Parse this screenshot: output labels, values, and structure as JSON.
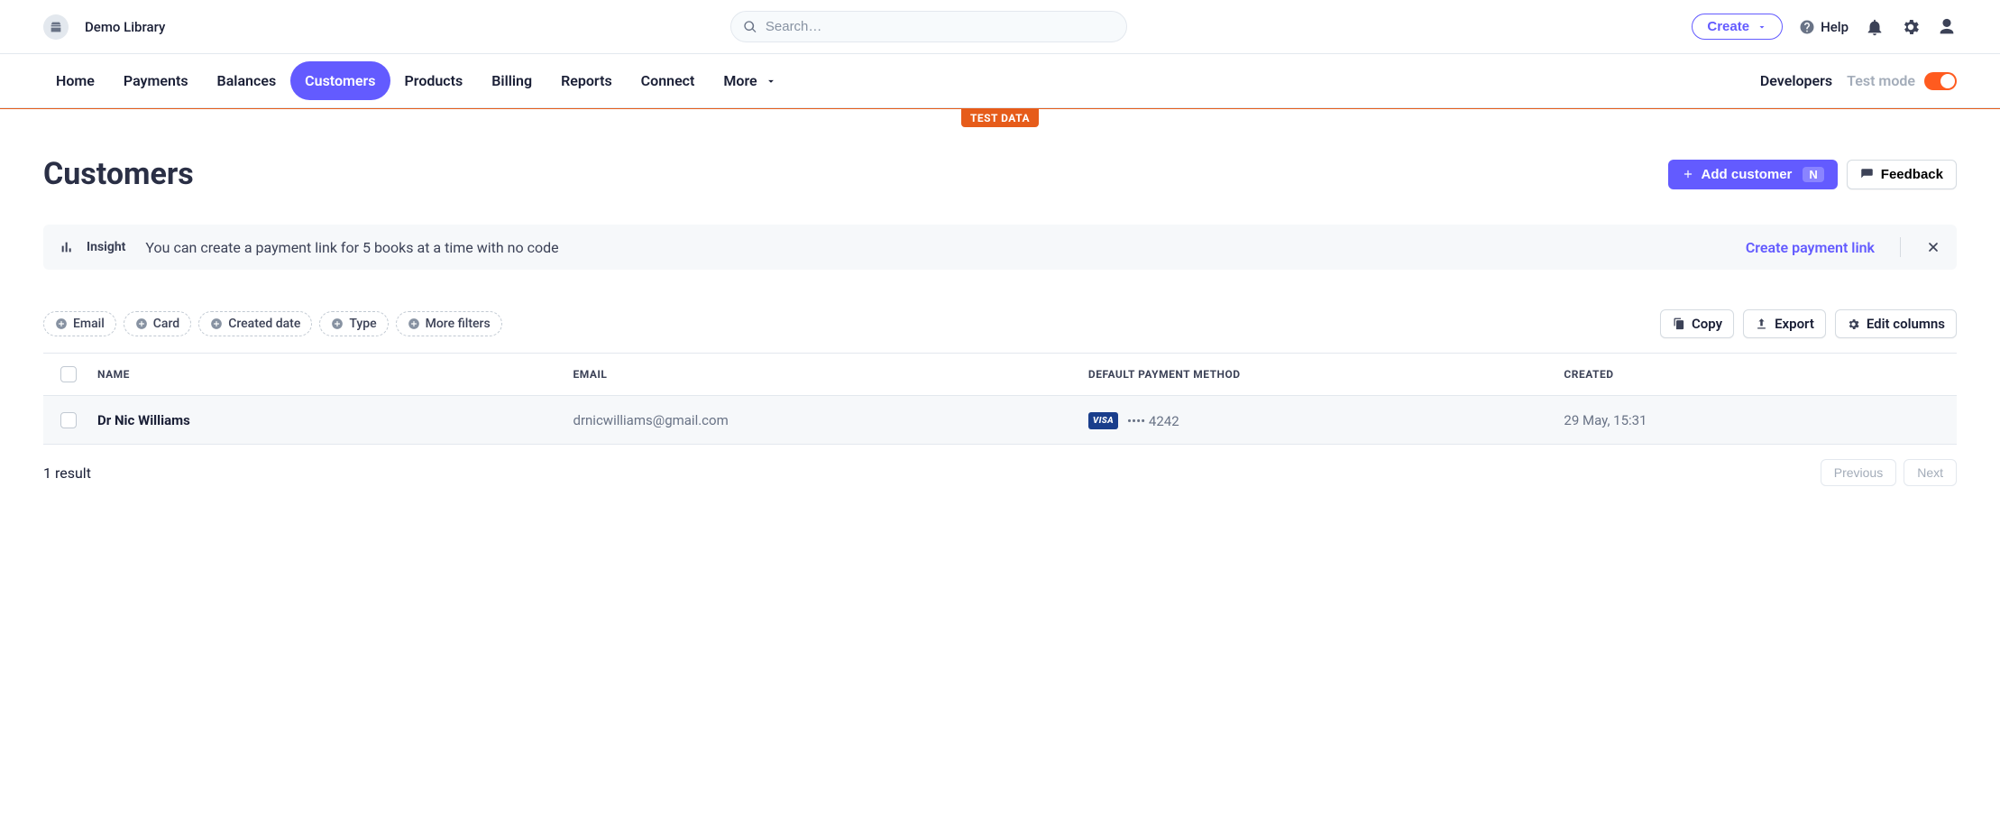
{
  "topbar": {
    "account_name": "Demo Library",
    "search_placeholder": "Search…",
    "create_label": "Create",
    "help_label": "Help"
  },
  "nav": {
    "items": [
      "Home",
      "Payments",
      "Balances",
      "Customers",
      "Products",
      "Billing",
      "Reports",
      "Connect",
      "More"
    ],
    "active_index": 3,
    "developers": "Developers",
    "testmode": "Test mode"
  },
  "testdata_badge": "TEST DATA",
  "page": {
    "title": "Customers",
    "add_customer": "Add customer",
    "add_customer_kbd": "N",
    "feedback": "Feedback"
  },
  "insight": {
    "label": "Insight",
    "text": "You can create a payment link for 5 books at a time with no code",
    "link": "Create payment link"
  },
  "filters": [
    "Email",
    "Card",
    "Created date",
    "Type",
    "More filters"
  ],
  "tools": {
    "copy": "Copy",
    "export": "Export",
    "edit_columns": "Edit columns"
  },
  "table": {
    "headers": {
      "name": "NAME",
      "email": "EMAIL",
      "payment": "DEFAULT PAYMENT METHOD",
      "created": "CREATED"
    },
    "rows": [
      {
        "name": "Dr Nic Williams",
        "email": "drnicwilliams@gmail.com",
        "card_brand": "VISA",
        "card_mask": "•••• 4242",
        "created": "29 May, 15:31"
      }
    ]
  },
  "footer": {
    "result_count": "1 result",
    "previous": "Previous",
    "next": "Next"
  }
}
